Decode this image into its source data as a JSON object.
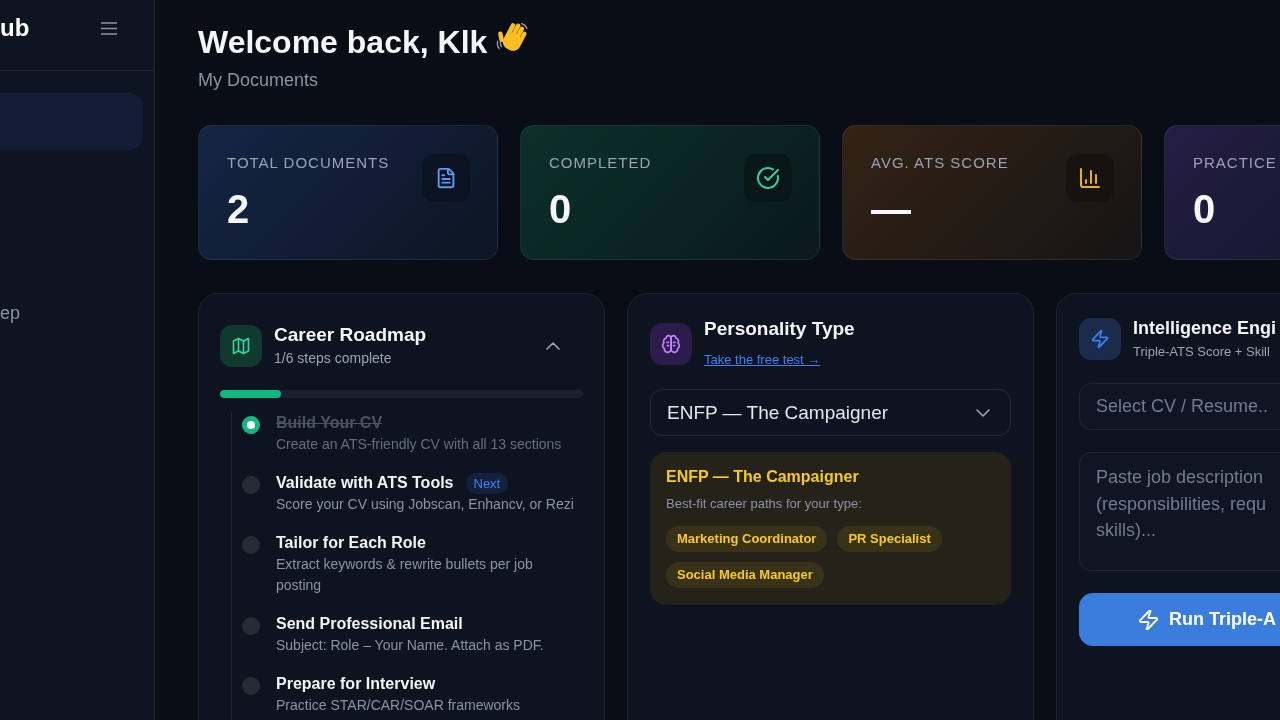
{
  "sidebar": {
    "brand": "ub",
    "items": [
      {
        "selected": true
      },
      {
        "label": "ep",
        "selected": false
      }
    ]
  },
  "header": {
    "title": "Welcome back, Klk",
    "subtitle": "My Documents"
  },
  "stats": [
    {
      "label": "TOTAL DOCUMENTS",
      "value": "2",
      "kind": "documents"
    },
    {
      "label": "COMPLETED",
      "value": "0",
      "kind": "completed"
    },
    {
      "label": "AVG. ATS SCORE",
      "value": "—",
      "kind": "score"
    },
    {
      "label": "PRACTICE",
      "value": "0",
      "kind": "practice"
    }
  ],
  "roadmap": {
    "title": "Career Roadmap",
    "subtitle": "1/6 steps complete",
    "expanded": true,
    "progress": {
      "level": 0.167
    },
    "steps": [
      {
        "title": "Build Your CV",
        "description": "Create an ATS-friendly CV with all 13 sections",
        "completed": true
      },
      {
        "title": "Validate with ATS Tools",
        "description": "Score your CV using Jobscan, Enhancv, or Rezi",
        "completed": false,
        "badge": "Next"
      },
      {
        "title": "Tailor for Each Role",
        "description": "Extract keywords & rewrite bullets per job posting",
        "completed": false
      },
      {
        "title": "Send Professional Email",
        "description": "Subject: Role – Your Name. Attach as PDF.",
        "completed": false
      },
      {
        "title": "Prepare for Interview",
        "description": "Practice STAR/CAR/SOAR frameworks",
        "completed": false
      }
    ]
  },
  "personality": {
    "title": "Personality Type",
    "link": "Take the free test →",
    "select": {
      "value": "ENFP — The Campaigner"
    },
    "result": {
      "title": "ENFP — The Campaigner",
      "subtitle": "Best-fit career paths for your type:",
      "careers": [
        "Marketing Coordinator",
        "PR Specialist",
        "Social Media Manager"
      ]
    }
  },
  "intelligence": {
    "title": "Intelligence Engi",
    "subtitle": "Triple-ATS Score + Skill",
    "cv_select": {
      "placeholder": "Select CV / Resume.."
    },
    "job_description": {
      "placeholder": "Paste job description\n(responsibilities, requ\nskills)..."
    },
    "run_button": "Run Triple-A"
  }
}
